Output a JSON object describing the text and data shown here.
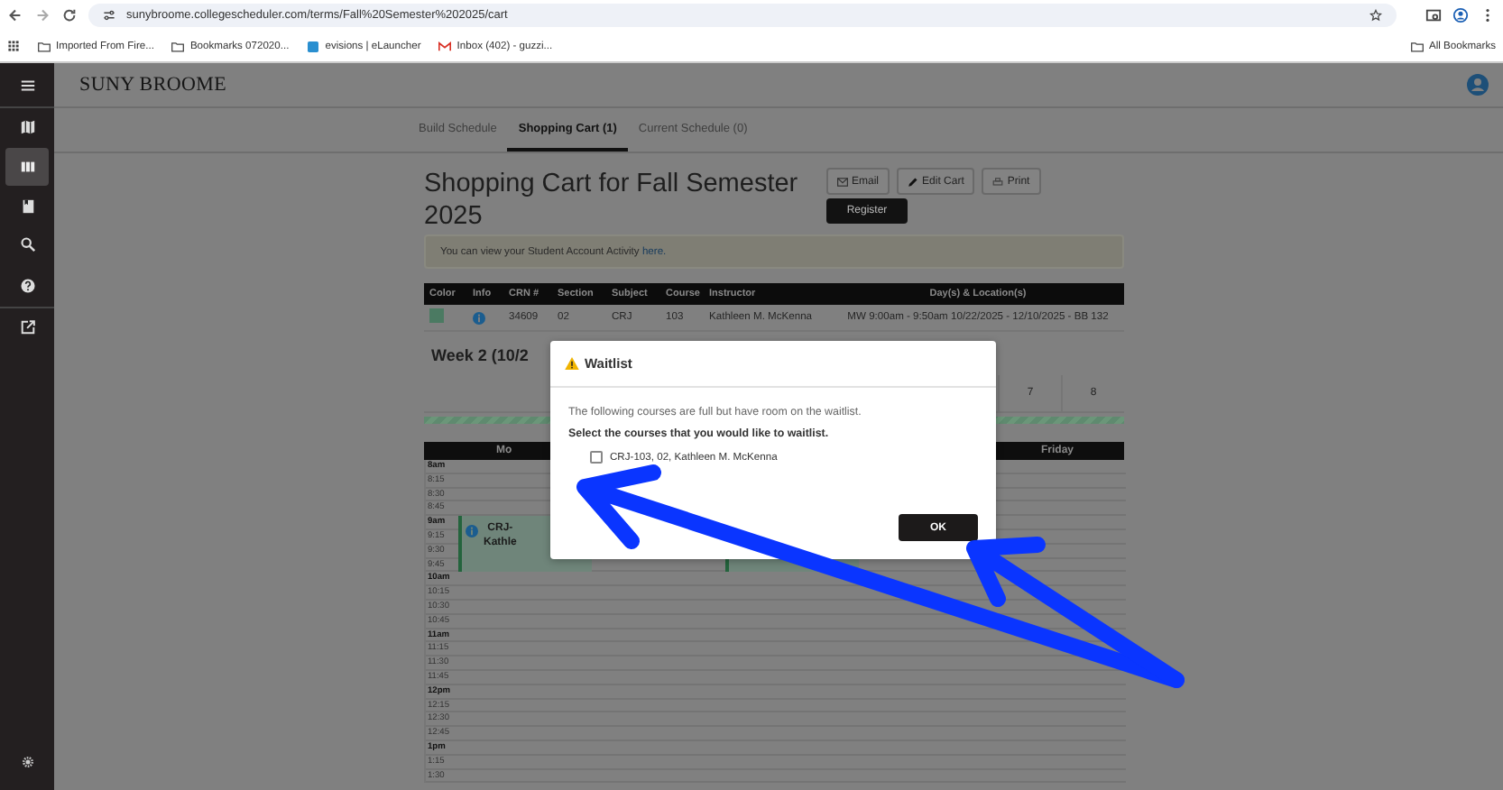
{
  "browser": {
    "url": "sunybroome.collegescheduler.com/terms/Fall%20Semester%202025/cart",
    "bookmarks": [
      {
        "label": "Imported From Fire...",
        "kind": "folder"
      },
      {
        "label": "Bookmarks 072020...",
        "kind": "folder"
      },
      {
        "label": "evisions | eLauncher",
        "kind": "site"
      },
      {
        "label": "Inbox (402) - guzzi...",
        "kind": "mail"
      }
    ],
    "all_bookmarks": "All Bookmarks"
  },
  "sidebar": {
    "items": [
      {
        "kind": "menu",
        "selected": false
      },
      {
        "kind": "map",
        "selected": false
      },
      {
        "kind": "columns",
        "selected": true
      },
      {
        "kind": "book",
        "selected": false
      },
      {
        "kind": "search",
        "selected": false
      },
      {
        "kind": "help",
        "selected": false
      },
      {
        "kind": "external",
        "selected": false
      }
    ]
  },
  "header": {
    "logo": "SUNY BROOME"
  },
  "tabs": [
    {
      "label": "Build Schedule",
      "selected": false
    },
    {
      "label": "Shopping Cart (1)",
      "selected": true
    },
    {
      "label": "Current Schedule (0)",
      "selected": false
    }
  ],
  "cart": {
    "title": "Shopping Cart for Fall Semester 2025",
    "buttons": [
      {
        "label": "Email",
        "kind": "email"
      },
      {
        "label": "Edit Cart",
        "kind": "edit"
      },
      {
        "label": "Print",
        "kind": "print"
      }
    ],
    "register": "Register",
    "notice": {
      "text": "You can view your Student Account Activity ",
      "link": "here."
    }
  },
  "courses": {
    "columns": [
      "Color",
      "Info",
      "CRN #",
      "Section",
      "Subject",
      "Course",
      "Instructor",
      "Day(s) & Location(s)"
    ],
    "rows": [
      {
        "color": "#4b7a62",
        "crn": "34609",
        "section": "02",
        "subject": "CRJ",
        "course": "103",
        "instructor": "Kathleen M. McKenna",
        "schedule": "MW 9:00am - 9:50am 10/22/2025 - 12/10/2025 - BB 132"
      }
    ]
  },
  "week": {
    "title": "Week 2 (10/2",
    "numbers": [
      "7",
      "8"
    ]
  },
  "calendar": {
    "first_day": "Mo",
    "last_day": "Friday",
    "times": [
      "8am",
      "8:15",
      "8:30",
      "8:45",
      "9am",
      "9:15",
      "9:30",
      "9:45",
      "10am",
      "10:15",
      "10:30",
      "10:45",
      "11am",
      "11:15",
      "11:30",
      "11:45",
      "12pm",
      "12:15",
      "12:30",
      "12:45",
      "1pm",
      "1:15",
      "1:30"
    ],
    "events": [
      {
        "kind": "monday",
        "lines": [
          "CRJ-",
          "Kathle"
        ]
      },
      {
        "kind": "wednesday"
      }
    ]
  },
  "modal": {
    "title": "Waitlist",
    "message": "The following courses are full but have room on the waitlist.",
    "prompt": "Select the courses that you would like to waitlist.",
    "options": [
      {
        "label": "CRJ-103, 02, Kathleen M. McKenna",
        "checked": false
      }
    ],
    "ok": "OK"
  }
}
